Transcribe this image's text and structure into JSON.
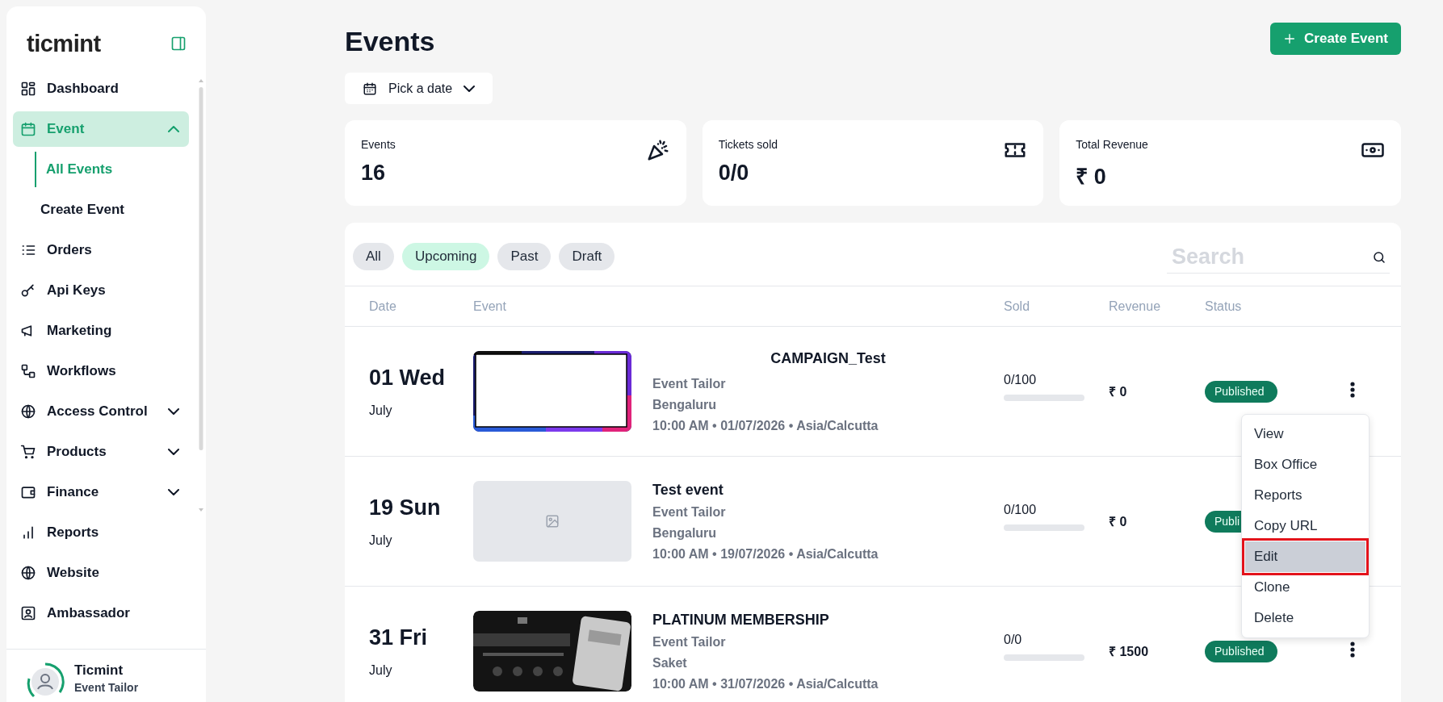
{
  "sidebar": {
    "logo": "ticmint",
    "items": [
      {
        "label": "Dashboard",
        "selected": false
      },
      {
        "label": "Event",
        "selected": true,
        "expanded": true,
        "children": [
          {
            "label": "All Events",
            "selected": true
          },
          {
            "label": "Create Event",
            "selected": false
          }
        ]
      },
      {
        "label": "Orders",
        "selected": false
      },
      {
        "label": "Api Keys",
        "selected": false
      },
      {
        "label": "Marketing",
        "selected": false
      },
      {
        "label": "Workflows",
        "selected": false
      },
      {
        "label": "Access Control",
        "selected": false,
        "expanded": false
      },
      {
        "label": "Products",
        "selected": false,
        "expanded": false
      },
      {
        "label": "Finance",
        "selected": false,
        "expanded": false
      },
      {
        "label": "Reports",
        "selected": false
      },
      {
        "label": "Website",
        "selected": false
      },
      {
        "label": "Ambassador",
        "selected": false
      }
    ],
    "user": {
      "name": "Ticmint",
      "subtitle": "Event Tailor"
    }
  },
  "page": {
    "title": "Events",
    "create_button": "Create Event",
    "date_picker": "Pick a date"
  },
  "stats": [
    {
      "label": "Events",
      "value": "16"
    },
    {
      "label": "Tickets sold",
      "value": "0/0"
    },
    {
      "label": "Total Revenue",
      "value": "₹ 0"
    }
  ],
  "filters": [
    {
      "label": "All",
      "selected": false
    },
    {
      "label": "Upcoming",
      "selected": true
    },
    {
      "label": "Past",
      "selected": false
    },
    {
      "label": "Draft",
      "selected": false
    }
  ],
  "search": {
    "placeholder": "Search"
  },
  "table": {
    "columns": [
      "Date",
      "Event",
      "Sold",
      "Revenue",
      "Status"
    ],
    "rows": [
      {
        "day": "01 Wed",
        "month": "July",
        "title": "CAMPAIGN_Test",
        "title_centered": true,
        "organizer": "Event Tailor",
        "location": "Bengaluru",
        "when": "10:00 AM • 01/07/2026 • Asia/Calcutta",
        "sold": "0/100",
        "level": 0,
        "revenue": "₹ 0",
        "status": "Published",
        "menu_button": true
      },
      {
        "day": "19 Sun",
        "month": "July",
        "image": {
          "kind": "placeholder"
        },
        "title": "Test event",
        "title_centered": false,
        "organizer": "Event Tailor",
        "location": "Bengaluru",
        "when": "10:00 AM • 19/07/2026 • Asia/Calcutta",
        "sold": "0/100",
        "level": 0,
        "revenue": "₹ 0",
        "status": "Publi",
        "menu_button": false
      },
      {
        "day": "31 Fri",
        "month": "July",
        "title": "PLATINUM MEMBERSHIP",
        "title_centered": false,
        "organizer": "Event Tailor",
        "location": "Saket",
        "when": "10:00 AM • 31/07/2026 • Asia/Calcutta",
        "sold": "0/0",
        "level": 0,
        "revenue": "₹ 1500",
        "status": "Published",
        "menu_button": true
      }
    ]
  },
  "row_menu": {
    "items": [
      {
        "label": "View",
        "selected": false
      },
      {
        "label": "Box Office",
        "selected": false
      },
      {
        "label": "Reports",
        "selected": false
      },
      {
        "label": "Copy URL",
        "selected": false
      },
      {
        "label": "Edit",
        "selected": true
      },
      {
        "label": "Clone",
        "selected": false
      },
      {
        "label": "Delete",
        "selected": false
      }
    ]
  }
}
